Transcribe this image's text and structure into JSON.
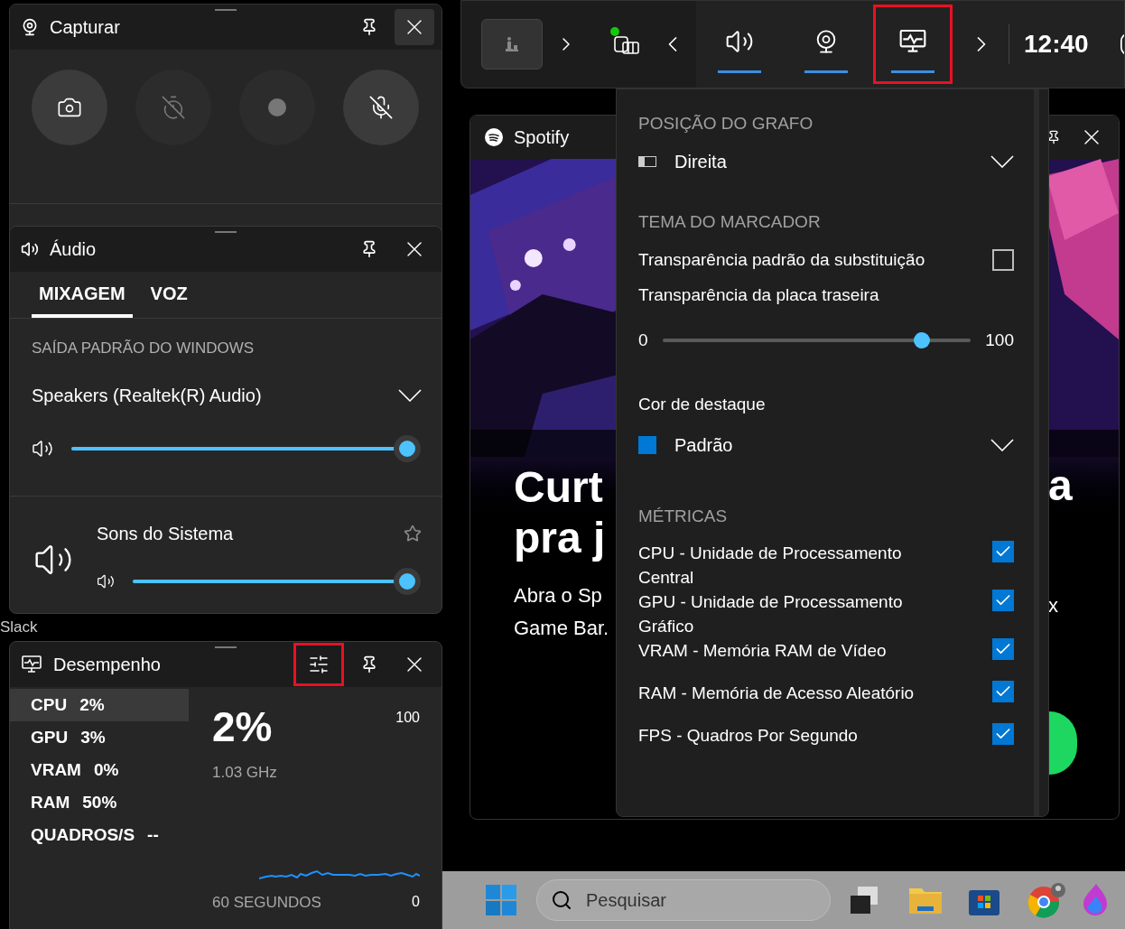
{
  "desktop": {
    "icon_labels": [
      {
        "text": "Slack"
      }
    ]
  },
  "top_bar": {
    "social_notification": true,
    "tabs": [
      {
        "kind": "audio",
        "active": true,
        "highlighted": false
      },
      {
        "kind": "capture",
        "active": true,
        "highlighted": false
      },
      {
        "kind": "performance",
        "active": true,
        "highlighted": true
      }
    ],
    "time": "12:40"
  },
  "capture": {
    "title": "Capturar",
    "buttons": [
      {
        "kind": "screenshot",
        "disabled": false
      },
      {
        "kind": "record-last",
        "disabled": true
      },
      {
        "kind": "record",
        "disabled": true
      },
      {
        "kind": "microphone",
        "disabled": false
      }
    ]
  },
  "audio": {
    "title": "Áudio",
    "tabs": [
      {
        "label": "MIXAGEM",
        "selected": true
      },
      {
        "label": "VOZ",
        "selected": false
      }
    ],
    "output_heading": "SAÍDA PADRÃO DO WINDOWS",
    "device": "Speakers (Realtek(R) Audio)",
    "master": {
      "level": 1
    },
    "apps": [
      {
        "name": "Sons do Sistema",
        "favorite": false,
        "level": 1
      }
    ]
  },
  "performance": {
    "title": "Desempenho",
    "settings_highlighted": true,
    "metrics": [
      {
        "label": "CPU",
        "value": "2%",
        "selected": true
      },
      {
        "label": "GPU",
        "value": "3%",
        "selected": false
      },
      {
        "label": "VRAM",
        "value": "0%",
        "selected": false
      },
      {
        "label": "RAM",
        "value": "50%",
        "selected": false
      },
      {
        "label": "QUADROS/S",
        "value": "--",
        "selected": false
      }
    ],
    "detail": {
      "value": "2%",
      "sub": "1.03 GHz",
      "max": "100",
      "min": "0",
      "span": "60 SEGUNDOS"
    }
  },
  "spotify": {
    "title": "Spotify",
    "headline": [
      "Curt",
      "pra j"
    ],
    "body": [
      "Abra o Sp",
      "Game Bar."
    ],
    "fragments": [
      "a",
      "x"
    ]
  },
  "settings": {
    "graph_position": {
      "heading": "POSIÇÃO DO GRAFO",
      "value": "Direita"
    },
    "theme": {
      "heading": "TEMA DO MARCADOR",
      "override_label": "Transparência padrão da substituição",
      "override_checked": false,
      "backplate_label": "Transparência da placa traseira",
      "min": "0",
      "max": "100",
      "level": 0.84
    },
    "accent": {
      "label": "Cor de destaque",
      "value": "Padrão",
      "color": "#0078d4"
    },
    "metrics": {
      "heading": "MÉTRICAS",
      "items": [
        {
          "label": "CPU - Unidade de Processamento Central",
          "checked": true
        },
        {
          "label": "GPU - Unidade de Processamento Gráfico",
          "checked": true
        },
        {
          "label": "VRAM - Memória RAM de Vídeo",
          "checked": true
        },
        {
          "label": "RAM - Memória de Acesso Aleatório",
          "checked": true
        },
        {
          "label": "FPS - Quadros Por Segundo",
          "checked": true
        }
      ]
    }
  },
  "taskbar": {
    "search_placeholder": "Pesquisar"
  }
}
